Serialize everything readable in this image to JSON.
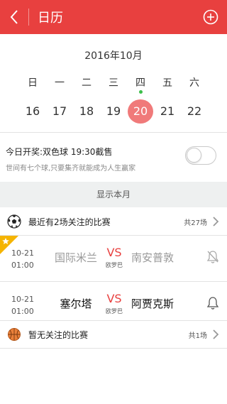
{
  "header": {
    "title": "日历"
  },
  "calendar": {
    "month_label": "2016年10月",
    "weekdays": [
      "日",
      "一",
      "二",
      "三",
      "四",
      "五",
      "六"
    ],
    "dates": [
      "16",
      "17",
      "18",
      "19",
      "20",
      "21",
      "22"
    ],
    "today": "20"
  },
  "lottery": {
    "title": "今日开奖:双色球 19:30截售",
    "subtitle": "世间有七个球,只要集齐就能成为人生赢家",
    "toggle_on": false
  },
  "show_month_label": "显示本月",
  "followed_section": {
    "title": "最近有2场关注的比赛",
    "count": "共27场"
  },
  "matches": [
    {
      "date": "10-21",
      "time": "01:00",
      "home": "国际米兰",
      "vs": "VS",
      "league": "欧罗巴",
      "away": "南安普敦",
      "dimmed": true,
      "starred": true
    },
    {
      "date": "10-21",
      "time": "01:00",
      "home": "塞尔塔",
      "vs": "VS",
      "league": "欧罗巴",
      "away": "阿贾克斯",
      "dimmed": false,
      "starred": false
    }
  ],
  "basketball_section": {
    "title": "暂无关注的比赛",
    "count": "共1场"
  },
  "colors": {
    "brand": "#e8403f",
    "today_bg": "#f07a7a",
    "today_dot": "#3cbf4a",
    "star": "#f5b400"
  },
  "icons": {
    "back": "back-arrow-icon",
    "add": "plus-circle-icon",
    "football": "football-icon",
    "basketball": "basketball-icon",
    "bell": "bell-icon",
    "chevron": "chevron-right-icon",
    "star": "star-icon"
  }
}
